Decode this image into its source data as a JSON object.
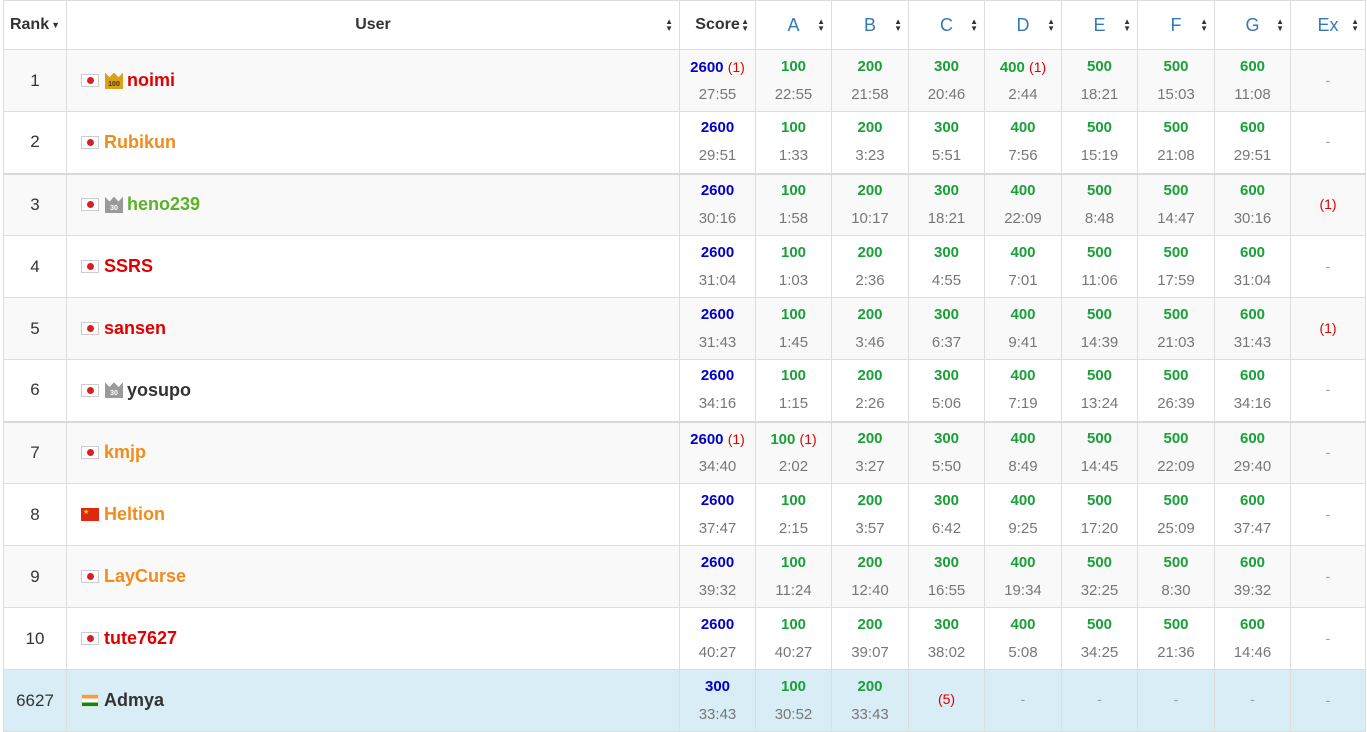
{
  "header": {
    "rank": "Rank",
    "user": "User",
    "score": "Score",
    "problems": [
      "A",
      "B",
      "C",
      "D",
      "E",
      "F",
      "G",
      "Ex"
    ]
  },
  "colors": {
    "total_score": "#0000cd",
    "accepted": "#19a038",
    "penalty": "#e00000",
    "problem_header": "#337ab7",
    "highlight_row": "#d9edf7",
    "rating_red": "#e00000",
    "rating_orange": "#f08c1c",
    "rating_green": "#5cb02a",
    "rating_darkgray": "#333333"
  },
  "rows": [
    {
      "rank": "1",
      "flag": "jp",
      "crown": "gold",
      "crown_text": "100",
      "name": "noimi",
      "name_color": "#e00000",
      "score": "2600",
      "score_pen": "(1)",
      "score_time": "27:55",
      "cells": [
        {
          "pts": "100",
          "pen": "",
          "time": "22:55"
        },
        {
          "pts": "200",
          "pen": "",
          "time": "21:58"
        },
        {
          "pts": "300",
          "pen": "",
          "time": "20:46"
        },
        {
          "pts": "400",
          "pen": "(1)",
          "time": "2:44"
        },
        {
          "pts": "500",
          "pen": "",
          "time": "18:21"
        },
        {
          "pts": "500",
          "pen": "",
          "time": "15:03"
        },
        {
          "pts": "600",
          "pen": "",
          "time": "11:08"
        }
      ],
      "ex": "-"
    },
    {
      "rank": "2",
      "flag": "jp",
      "crown": "",
      "crown_text": "",
      "name": "Rubikun",
      "name_color": "#f08c1c",
      "score": "2600",
      "score_pen": "",
      "score_time": "29:51",
      "cells": [
        {
          "pts": "100",
          "pen": "",
          "time": "1:33"
        },
        {
          "pts": "200",
          "pen": "",
          "time": "3:23"
        },
        {
          "pts": "300",
          "pen": "",
          "time": "5:51"
        },
        {
          "pts": "400",
          "pen": "",
          "time": "7:56"
        },
        {
          "pts": "500",
          "pen": "",
          "time": "15:19"
        },
        {
          "pts": "500",
          "pen": "",
          "time": "21:08"
        },
        {
          "pts": "600",
          "pen": "",
          "time": "29:51"
        }
      ],
      "ex": "-"
    },
    {
      "rank": "3",
      "flag": "jp",
      "crown": "silver",
      "crown_text": "30",
      "name": "heno239",
      "name_color": "#5cb02a",
      "score": "2600",
      "score_pen": "",
      "score_time": "30:16",
      "cells": [
        {
          "pts": "100",
          "pen": "",
          "time": "1:58"
        },
        {
          "pts": "200",
          "pen": "",
          "time": "10:17"
        },
        {
          "pts": "300",
          "pen": "",
          "time": "18:21"
        },
        {
          "pts": "400",
          "pen": "",
          "time": "22:09"
        },
        {
          "pts": "500",
          "pen": "",
          "time": "8:48"
        },
        {
          "pts": "500",
          "pen": "",
          "time": "14:47"
        },
        {
          "pts": "600",
          "pen": "",
          "time": "30:16"
        }
      ],
      "ex": "(1)"
    },
    {
      "rank": "4",
      "flag": "jp",
      "crown": "",
      "crown_text": "",
      "name": "SSRS",
      "name_color": "#e00000",
      "score": "2600",
      "score_pen": "",
      "score_time": "31:04",
      "cells": [
        {
          "pts": "100",
          "pen": "",
          "time": "1:03"
        },
        {
          "pts": "200",
          "pen": "",
          "time": "2:36"
        },
        {
          "pts": "300",
          "pen": "",
          "time": "4:55"
        },
        {
          "pts": "400",
          "pen": "",
          "time": "7:01"
        },
        {
          "pts": "500",
          "pen": "",
          "time": "11:06"
        },
        {
          "pts": "500",
          "pen": "",
          "time": "17:59"
        },
        {
          "pts": "600",
          "pen": "",
          "time": "31:04"
        }
      ],
      "ex": "-"
    },
    {
      "rank": "5",
      "flag": "jp",
      "crown": "",
      "crown_text": "",
      "name": "sansen",
      "name_color": "#e00000",
      "score": "2600",
      "score_pen": "",
      "score_time": "31:43",
      "cells": [
        {
          "pts": "100",
          "pen": "",
          "time": "1:45"
        },
        {
          "pts": "200",
          "pen": "",
          "time": "3:46"
        },
        {
          "pts": "300",
          "pen": "",
          "time": "6:37"
        },
        {
          "pts": "400",
          "pen": "",
          "time": "9:41"
        },
        {
          "pts": "500",
          "pen": "",
          "time": "14:39"
        },
        {
          "pts": "500",
          "pen": "",
          "time": "21:03"
        },
        {
          "pts": "600",
          "pen": "",
          "time": "31:43"
        }
      ],
      "ex": "(1)"
    },
    {
      "rank": "6",
      "flag": "jp",
      "crown": "silver",
      "crown_text": "30",
      "name": "yosupo",
      "name_color": "#333333",
      "score": "2600",
      "score_pen": "",
      "score_time": "34:16",
      "cells": [
        {
          "pts": "100",
          "pen": "",
          "time": "1:15"
        },
        {
          "pts": "200",
          "pen": "",
          "time": "2:26"
        },
        {
          "pts": "300",
          "pen": "",
          "time": "5:06"
        },
        {
          "pts": "400",
          "pen": "",
          "time": "7:19"
        },
        {
          "pts": "500",
          "pen": "",
          "time": "13:24"
        },
        {
          "pts": "500",
          "pen": "",
          "time": "26:39"
        },
        {
          "pts": "600",
          "pen": "",
          "time": "34:16"
        }
      ],
      "ex": "-"
    },
    {
      "rank": "7",
      "flag": "jp",
      "crown": "",
      "crown_text": "",
      "name": "kmjp",
      "name_color": "#f08c1c",
      "score": "2600",
      "score_pen": "(1)",
      "score_time": "34:40",
      "cells": [
        {
          "pts": "100",
          "pen": "(1)",
          "time": "2:02"
        },
        {
          "pts": "200",
          "pen": "",
          "time": "3:27"
        },
        {
          "pts": "300",
          "pen": "",
          "time": "5:50"
        },
        {
          "pts": "400",
          "pen": "",
          "time": "8:49"
        },
        {
          "pts": "500",
          "pen": "",
          "time": "14:45"
        },
        {
          "pts": "500",
          "pen": "",
          "time": "22:09"
        },
        {
          "pts": "600",
          "pen": "",
          "time": "29:40"
        }
      ],
      "ex": "-"
    },
    {
      "rank": "8",
      "flag": "cn",
      "crown": "",
      "crown_text": "",
      "name": "Heltion",
      "name_color": "#f08c1c",
      "score": "2600",
      "score_pen": "",
      "score_time": "37:47",
      "cells": [
        {
          "pts": "100",
          "pen": "",
          "time": "2:15"
        },
        {
          "pts": "200",
          "pen": "",
          "time": "3:57"
        },
        {
          "pts": "300",
          "pen": "",
          "time": "6:42"
        },
        {
          "pts": "400",
          "pen": "",
          "time": "9:25"
        },
        {
          "pts": "500",
          "pen": "",
          "time": "17:20"
        },
        {
          "pts": "500",
          "pen": "",
          "time": "25:09"
        },
        {
          "pts": "600",
          "pen": "",
          "time": "37:47"
        }
      ],
      "ex": "-"
    },
    {
      "rank": "9",
      "flag": "jp",
      "crown": "",
      "crown_text": "",
      "name": "LayCurse",
      "name_color": "#f08c1c",
      "score": "2600",
      "score_pen": "",
      "score_time": "39:32",
      "cells": [
        {
          "pts": "100",
          "pen": "",
          "time": "11:24"
        },
        {
          "pts": "200",
          "pen": "",
          "time": "12:40"
        },
        {
          "pts": "300",
          "pen": "",
          "time": "16:55"
        },
        {
          "pts": "400",
          "pen": "",
          "time": "19:34"
        },
        {
          "pts": "500",
          "pen": "",
          "time": "32:25"
        },
        {
          "pts": "500",
          "pen": "",
          "time": "8:30"
        },
        {
          "pts": "600",
          "pen": "",
          "time": "39:32"
        }
      ],
      "ex": "-"
    },
    {
      "rank": "10",
      "flag": "jp",
      "crown": "",
      "crown_text": "",
      "name": "tute7627",
      "name_color": "#e00000",
      "score": "2600",
      "score_pen": "",
      "score_time": "40:27",
      "cells": [
        {
          "pts": "100",
          "pen": "",
          "time": "40:27"
        },
        {
          "pts": "200",
          "pen": "",
          "time": "39:07"
        },
        {
          "pts": "300",
          "pen": "",
          "time": "38:02"
        },
        {
          "pts": "400",
          "pen": "",
          "time": "5:08"
        },
        {
          "pts": "500",
          "pen": "",
          "time": "34:25"
        },
        {
          "pts": "500",
          "pen": "",
          "time": "21:36"
        },
        {
          "pts": "600",
          "pen": "",
          "time": "14:46"
        }
      ],
      "ex": "-"
    },
    {
      "rank": "6627",
      "flag": "in",
      "crown": "",
      "crown_text": "",
      "name": "Admya",
      "name_color": "#333333",
      "highlight": true,
      "score": "300",
      "score_pen": "",
      "score_time": "33:43",
      "cells": [
        {
          "pts": "100",
          "pen": "",
          "time": "30:52"
        },
        {
          "pts": "200",
          "pen": "",
          "time": "33:43"
        },
        {
          "pts": "",
          "pen": "",
          "time": "",
          "wa": "(5)"
        },
        {
          "dash": "-"
        },
        {
          "dash": "-"
        },
        {
          "dash": "-"
        },
        {
          "dash": "-"
        }
      ],
      "ex": "-"
    }
  ]
}
